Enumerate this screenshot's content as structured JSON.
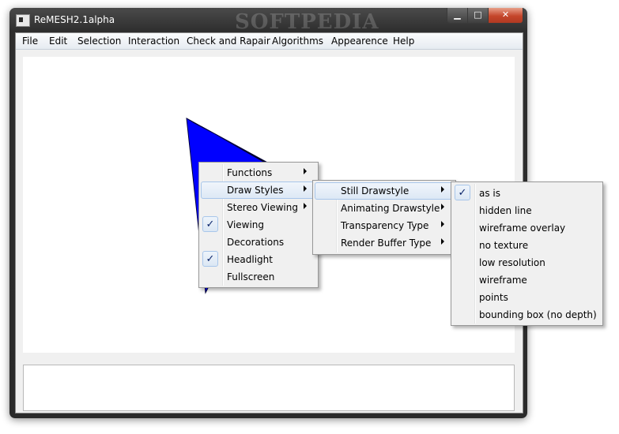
{
  "window": {
    "title": "ReMESH2.1alpha",
    "watermark": "SOFTPEDIA",
    "min_glyph": "▁",
    "max_glyph": "□",
    "close_glyph": "✕"
  },
  "menubar": {
    "items": [
      "File",
      "Edit",
      "Selection",
      "Interaction",
      "Check and Rapair",
      "Algorithms",
      "Appearence",
      "Help"
    ]
  },
  "viewport": {
    "shape_color": "#0000ff"
  },
  "context_menu": {
    "items": [
      {
        "label": "Functions",
        "submenu": true,
        "checked": false
      },
      {
        "label": "Draw Styles",
        "submenu": true,
        "checked": false,
        "highlighted": true
      },
      {
        "label": "Stereo Viewing",
        "submenu": true,
        "checked": false
      },
      {
        "label": "Viewing",
        "submenu": false,
        "checked": true
      },
      {
        "label": "Decorations",
        "submenu": false,
        "checked": false
      },
      {
        "label": "Headlight",
        "submenu": false,
        "checked": true
      },
      {
        "label": "Fullscreen",
        "submenu": false,
        "checked": false
      }
    ]
  },
  "draw_styles_menu": {
    "items": [
      {
        "label": "Still Drawstyle",
        "submenu": true,
        "highlighted": true
      },
      {
        "label": "Animating Drawstyle",
        "submenu": true
      },
      {
        "label": "Transparency Type",
        "submenu": true
      },
      {
        "label": "Render Buffer Type",
        "submenu": true
      }
    ]
  },
  "still_drawstyle_menu": {
    "items": [
      {
        "label": "as is",
        "checked": true
      },
      {
        "label": "hidden line",
        "checked": false
      },
      {
        "label": "wireframe overlay",
        "checked": false
      },
      {
        "label": "no texture",
        "checked": false
      },
      {
        "label": "low resolution",
        "checked": false
      },
      {
        "label": "wireframe",
        "checked": false
      },
      {
        "label": "points",
        "checked": false
      },
      {
        "label": "bounding box (no depth)",
        "checked": false
      }
    ]
  },
  "check_glyph": "✓"
}
